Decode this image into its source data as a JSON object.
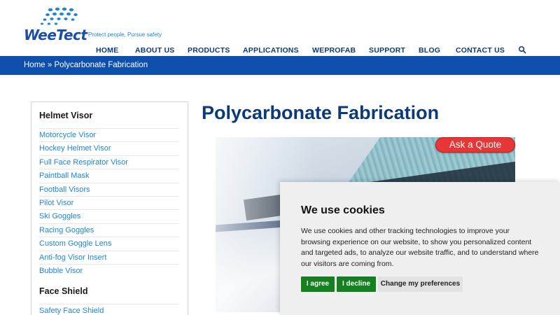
{
  "brand": {
    "name": "WeeTect",
    "tagline": "Protect people, Pursue safety",
    "colors": {
      "primary": "#0b3a78",
      "bar": "#0e4fae",
      "link": "#1f86d6",
      "accent": "#e83535",
      "cookie_green": "#15801f"
    }
  },
  "nav": {
    "items": [
      "HOME",
      "ABOUT US",
      "PRODUCTS",
      "APPLICATIONS",
      "WEPROFAB",
      "SUPPORT",
      "BLOG",
      "CONTACT US"
    ],
    "search_icon": "search-icon"
  },
  "breadcrumb": {
    "home": "Home",
    "separator": "»",
    "current": "Polycarbonate Fabrication"
  },
  "sidebar": {
    "sections": [
      {
        "heading": "Helmet Visor",
        "items": [
          "Motorcycle Visor",
          "Hockey Helmet Visor",
          "Full Face Respirator Visor",
          "Paintball Mask",
          "Football Visors",
          "Pilot Visor",
          "Ski Goggles",
          "Racing Goggles",
          "Custom Goggle Lens",
          "Anti-fog Visor Insert",
          "Bubble Visor"
        ]
      },
      {
        "heading": "Face Shield",
        "items": [
          "Safety Face Shield"
        ]
      }
    ]
  },
  "main": {
    "title": "Polycarbonate Fabrication",
    "quote_button": "Ask a Quote"
  },
  "cookie": {
    "title": "We use cookies",
    "text": "We use cookies and other tracking technologies to improve your browsing experience on our website, to show you personalized content and targeted ads, to analyze our website traffic, and to understand where our visitors are coming from.",
    "agree": "I agree",
    "decline": "I decline",
    "preferences": "Change my preferences"
  }
}
